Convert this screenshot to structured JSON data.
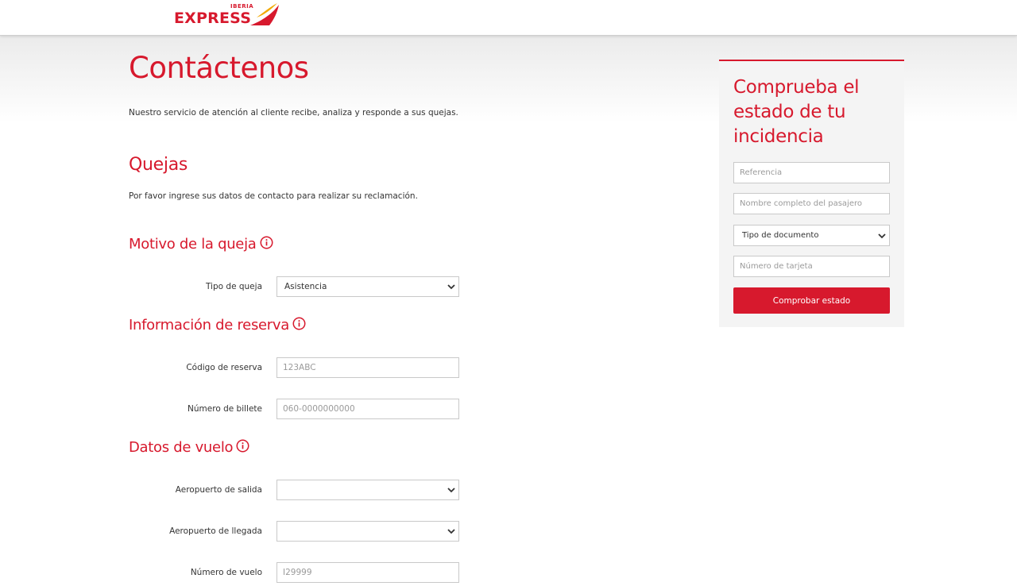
{
  "header": {
    "logo_small": "IBERIA",
    "logo_main": "EXPRESS"
  },
  "colors": {
    "brand_red": "#d7192d",
    "sidebar_bg": "#f4f4f4"
  },
  "main": {
    "title": "Contáctenos",
    "intro": "Nuestro servicio de atención al cliente recibe, analiza y responde a sus quejas.",
    "complaints": {
      "title": "Quejas",
      "description": "Por favor ingrese sus datos de contacto para realizar su reclamación."
    },
    "reason": {
      "title": "Motivo de la queja",
      "icon": "info-icon",
      "complaint_type": {
        "label": "Tipo de queja",
        "value": "Asistencia"
      }
    },
    "booking": {
      "title": "Información de reserva",
      "icon": "info-icon",
      "booking_code": {
        "label": "Código de reserva",
        "placeholder": "123ABC"
      },
      "ticket_number": {
        "label": "Número de billete",
        "placeholder": "060-0000000000"
      }
    },
    "flight": {
      "title": "Datos de vuelo",
      "icon": "info-icon",
      "departure_airport": {
        "label": "Aeropuerto de salida",
        "value": ""
      },
      "arrival_airport": {
        "label": "Aeropuerto de llegada",
        "value": ""
      },
      "flight_number": {
        "label": "Número de vuelo",
        "placeholder": "I29999"
      }
    }
  },
  "sidebar": {
    "title": "Comprueba el estado de tu incidencia",
    "reference_placeholder": "Referencia",
    "passenger_placeholder": "Nombre completo del pasajero",
    "document_type_value": "Tipo de documento",
    "card_number_placeholder": "Número de tarjeta",
    "check_button": "Comprobar estado"
  }
}
